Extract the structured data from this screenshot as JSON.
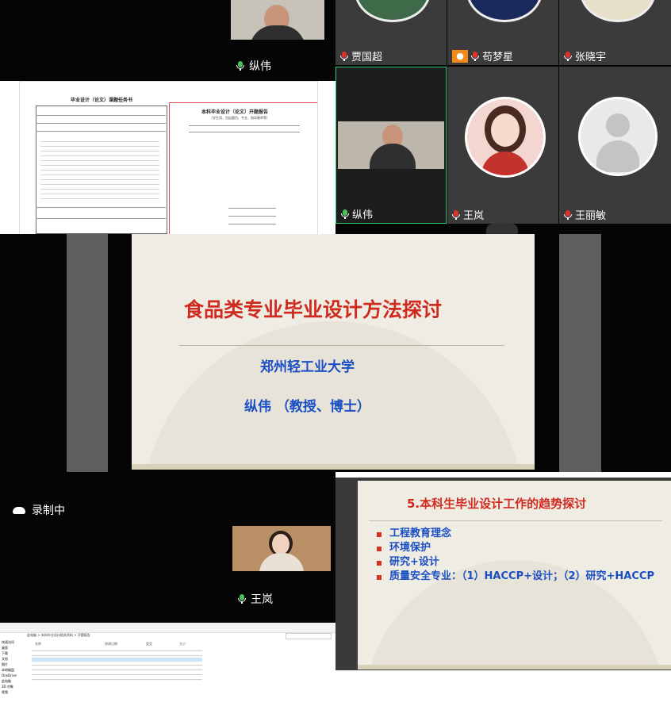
{
  "top_left_speaker": {
    "name": "纵伟"
  },
  "participants": [
    {
      "name": "贾国超"
    },
    {
      "name": "苟梦星"
    },
    {
      "name": "张晓宇"
    },
    {
      "name": "纵伟"
    },
    {
      "name": "王岚"
    },
    {
      "name": "王丽敏"
    }
  ],
  "doc": {
    "title": "毕业设计（论文）课题任务书",
    "right_title": "本科毕业设计（论文）开题报告",
    "right_sub": "（学生用，包括题目、专业、指导教师等）"
  },
  "main_slide": {
    "title": "食品类专业毕业设计方法探讨",
    "university": "郑州轻工业大学",
    "author": "纵伟 （教授、博士）"
  },
  "recording": {
    "label": "录制中"
  },
  "bottom_speaker": {
    "name": "王岚"
  },
  "side_slide": {
    "title": "5.本科生毕业设计工作的趋势探讨",
    "bullets": [
      "工程教育理念",
      "环境保护",
      "研究+设计",
      "质量安全专业：（1）HACCP+设计；（2）研究+HACCP"
    ]
  },
  "explorer": {
    "breadcrumb": "此电脑 > 本科毕业设计相关资料 > 开题报告",
    "sidebar": [
      "快速访问",
      "桌面",
      "下载",
      "文档",
      "图片",
      "本地磁盘",
      "OneDrive",
      "此电脑",
      "3D 对象",
      "视频"
    ],
    "columns": [
      "名称",
      "修改日期",
      "类型",
      "大小"
    ]
  },
  "colors": {
    "slide_title_red": "#d02a1f",
    "slide_blue": "#1a4fc4",
    "bullet_red": "#d23222"
  }
}
